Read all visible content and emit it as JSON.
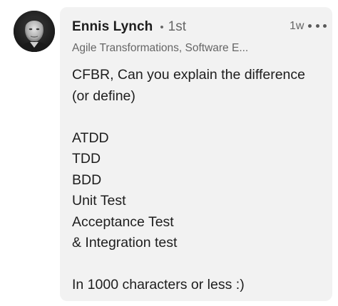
{
  "author": {
    "name": "Ennis Lynch",
    "degree": "1st",
    "headline": "Agile Transformations, Software E..."
  },
  "timestamp": "1w",
  "more_icon": "more-horizontal-icon",
  "avatar_icon": "profile-photo",
  "colors": {
    "bubble": "#f2f2f2",
    "text": "#1d1d1d",
    "muted": "#666666"
  },
  "message": {
    "lines": [
      "CFBR, Can you explain the difference",
      "(or define)",
      "",
      "ATDD",
      "TDD",
      "BDD",
      "Unit Test",
      "Acceptance Test",
      "& Integration test",
      "",
      "In 1000 characters or less :)"
    ]
  }
}
